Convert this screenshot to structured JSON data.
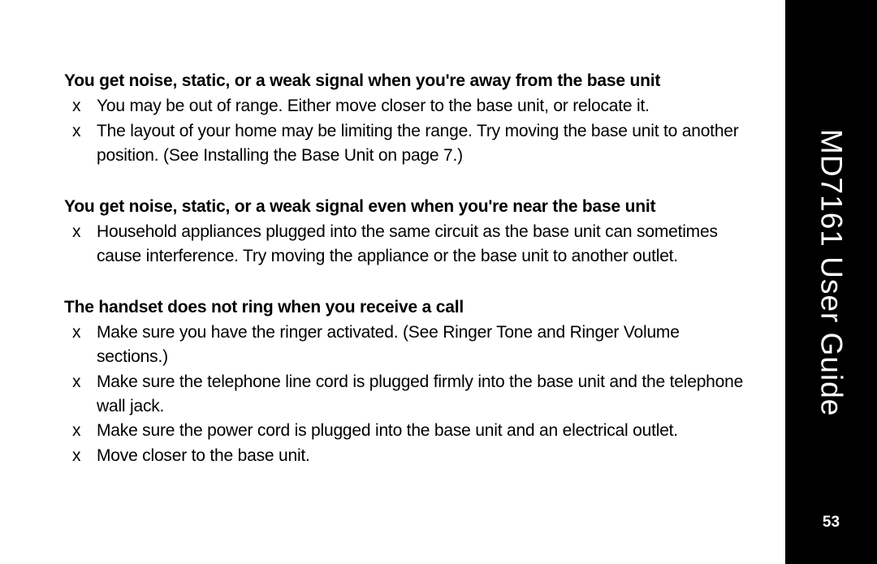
{
  "sidebar": {
    "title": "MD7161 User Guide",
    "page_number": "53"
  },
  "sections": [
    {
      "title": "You get noise, static, or a weak signal when you're away from the base unit",
      "items": [
        "You may be out of range. Either move closer to the base unit, or relocate it.",
        "The layout of your home may be limiting the range. Try moving the base unit to another position. (See Installing the Base Unit on page 7.)"
      ]
    },
    {
      "title": "You get noise, static, or a weak signal even when you're near the base unit",
      "items": [
        "Household appliances plugged into the same circuit as the base unit can sometimes cause interference. Try moving the appliance or the base unit to another outlet."
      ]
    },
    {
      "title": "The handset does not ring when you receive a call",
      "items": [
        "Make sure you have the ringer activated. (See Ringer Tone and Ringer Volume sections.)",
        "Make sure the telephone line cord is plugged firmly into the base unit and the telephone wall jack.",
        "Make sure the power cord is plugged into the base unit and an electrical outlet.",
        "Move closer to the base unit."
      ]
    }
  ],
  "bullet_marker": "x"
}
